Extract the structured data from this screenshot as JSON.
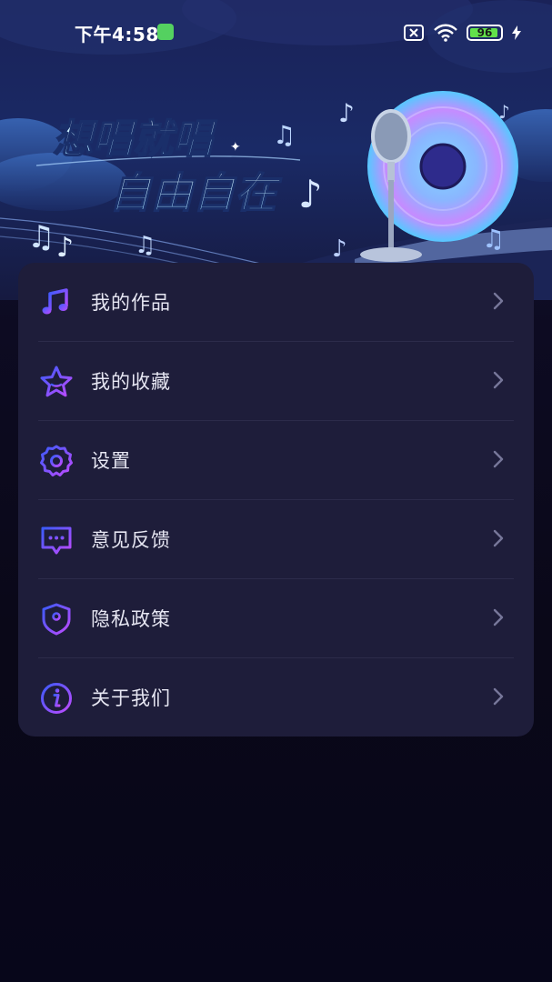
{
  "status_bar": {
    "time": "下午4:58",
    "battery_level": "96"
  },
  "banner": {
    "title_line1": "想唱就唱",
    "title_line2": "自由自在"
  },
  "menu": {
    "items": [
      {
        "label": "我的作品",
        "icon": "music-note-icon"
      },
      {
        "label": "我的收藏",
        "icon": "star-icon"
      },
      {
        "label": "设置",
        "icon": "gear-icon"
      },
      {
        "label": "意见反馈",
        "icon": "feedback-chat-icon"
      },
      {
        "label": "隐私政策",
        "icon": "shield-icon"
      },
      {
        "label": "关于我们",
        "icon": "info-icon"
      }
    ]
  },
  "colors": {
    "icon_gradient_start": "#3b5bff",
    "icon_gradient_end": "#c04bff",
    "card_background": "#1e1d3a",
    "page_background": "#0a0818"
  }
}
